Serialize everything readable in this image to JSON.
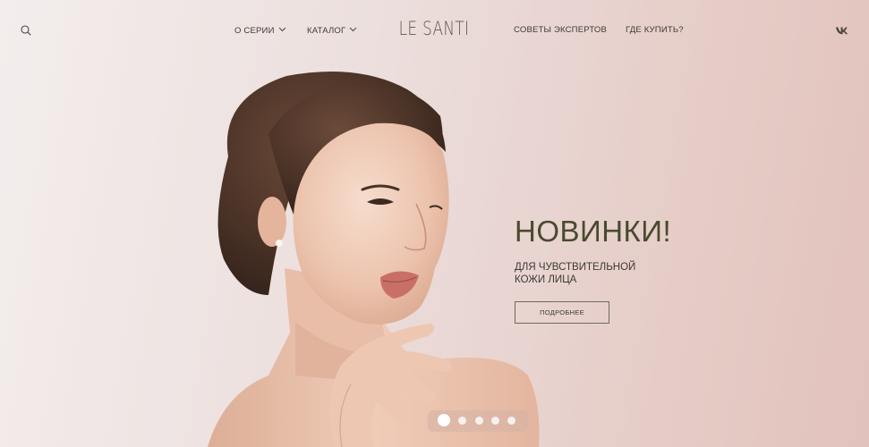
{
  "header": {
    "search_icon": "search-icon",
    "nav_left": [
      {
        "label": "О серии",
        "has_dropdown": true
      },
      {
        "label": "Каталог",
        "has_dropdown": true
      }
    ],
    "logo": "LE SANTI",
    "nav_right": [
      {
        "label": "Советы экспертов"
      },
      {
        "label": "Где купить?"
      }
    ],
    "social_icon": "vk-icon"
  },
  "hero": {
    "title": "НОВИНКИ!",
    "subtitle_line1": "для чувствительной",
    "subtitle_line2": "кожи лица",
    "button_label": "подробнее"
  },
  "slider": {
    "total_slides": 5,
    "active_index": 0
  },
  "colors": {
    "background_start": "#f3eeed",
    "background_end": "#e2c2bc",
    "title": "#4a4a2e",
    "text": "#3e3b33"
  }
}
